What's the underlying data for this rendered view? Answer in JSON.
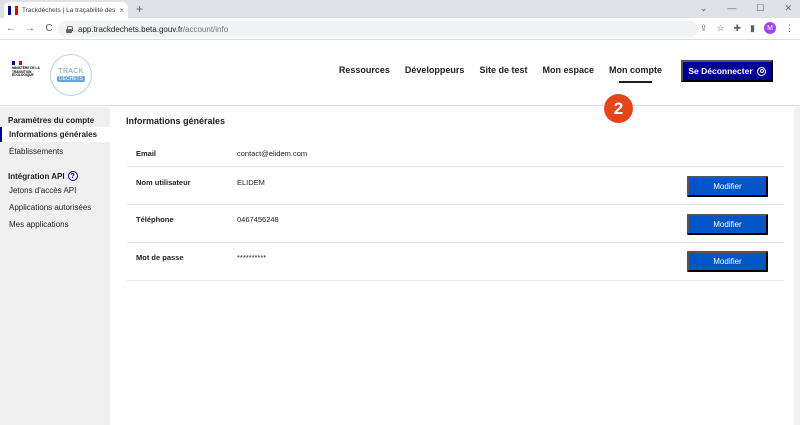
{
  "browser": {
    "tab_title": "Trackdéchets | La traçabilité des d",
    "tab_close": "×",
    "new_tab": "+",
    "url_host": "app.trackdechets.beta.gouv.fr",
    "url_path": "/account/info",
    "profile_initial": "M",
    "window_controls": {
      "chevron": "⌄",
      "minimize": "—",
      "maximize": "☐",
      "close": "✕"
    },
    "nav": {
      "back": "←",
      "forward": "→",
      "reload": "C"
    }
  },
  "header": {
    "ministry_text": "Ministère de la Transition Écologique",
    "logo_top": "TRACK",
    "logo_bottom": "DÉCHETS",
    "nav_items": [
      "Ressources",
      "Développeurs",
      "Site de test",
      "Mon espace",
      "Mon compte"
    ],
    "active_nav": "Mon compte",
    "logout_label": "Se Déconnecter"
  },
  "step_badge": "2",
  "sidebar": {
    "section1": "Paramètres du compte",
    "items1": [
      "Informations générales",
      "Établissements"
    ],
    "section2": "Intégration API",
    "help_glyph": "?",
    "items2": [
      "Jetons d'accès API",
      "Applications autorisées",
      "Mes applications"
    ]
  },
  "main": {
    "title": "Informations générales",
    "rows": [
      {
        "label": "Email",
        "value": "contact@elidem.com"
      },
      {
        "label": "Nom utilisateur",
        "value": "ELIDEM",
        "button": "Modifier"
      },
      {
        "label": "Téléphone",
        "value": "0467456248",
        "button": "Modifier"
      },
      {
        "label": "Mot de passe",
        "value": "**********",
        "button": "Modifier"
      }
    ]
  },
  "colors": {
    "primary": "#000091",
    "button_blue": "#0055c6",
    "badge_orange": "#e64419",
    "sidebar_bg": "#f0f0f0"
  }
}
